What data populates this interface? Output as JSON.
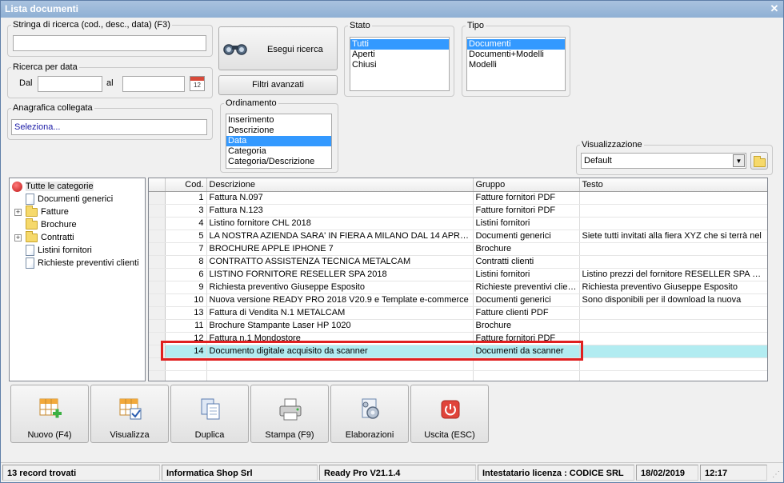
{
  "window": {
    "title": "Lista documenti",
    "close_glyph": "✕"
  },
  "search": {
    "legend": "Stringa di ricerca (cod., desc., data) (F3)",
    "value": ""
  },
  "date_search": {
    "legend": "Ricerca per data",
    "from_label": "Dal",
    "to_label": "al",
    "from_value": "",
    "to_value": "",
    "calendar_day": "12"
  },
  "linked_registry": {
    "legend": "Anagrafica collegata",
    "value": "Seleziona..."
  },
  "buttons": {
    "search": "Esegui ricerca",
    "advanced": "Filtri avanzati"
  },
  "ordering": {
    "legend": "Ordinamento",
    "options": [
      "Inserimento",
      "Descrizione",
      "Data",
      "Categoria",
      "Categoria/Descrizione"
    ],
    "selected": "Data"
  },
  "state": {
    "legend": "Stato",
    "options": [
      "Tutti",
      "Aperti",
      "Chiusi"
    ],
    "selected": "Tutti"
  },
  "type": {
    "legend": "Tipo",
    "options": [
      "Documenti",
      "Documenti+Modelli",
      "Modelli"
    ],
    "selected": "Documenti"
  },
  "view": {
    "legend": "Visualizzazione",
    "value": "Default"
  },
  "tree": {
    "root": "Tutte le categorie",
    "items": [
      {
        "label": "Documenti generici",
        "icon": "doc",
        "expandable": false
      },
      {
        "label": "Fatture",
        "icon": "folder",
        "expandable": true
      },
      {
        "label": "Brochure",
        "icon": "folder",
        "expandable": false
      },
      {
        "label": "Contratti",
        "icon": "folder",
        "expandable": true
      },
      {
        "label": "Listini fornitori",
        "icon": "doc",
        "expandable": false
      },
      {
        "label": "Richieste preventivi clienti",
        "icon": "doc",
        "expandable": false
      }
    ]
  },
  "grid": {
    "columns": [
      "Cod.",
      "Descrizione",
      "Gruppo",
      "Testo"
    ],
    "rows": [
      {
        "cod": "1",
        "desc": "Fattura N.097",
        "group": "Fatture fornitori PDF",
        "text": ""
      },
      {
        "cod": "3",
        "desc": "Fattura N.123",
        "group": "Fatture fornitori PDF",
        "text": ""
      },
      {
        "cod": "4",
        "desc": "Listino fornitore CHL 2018",
        "group": "Listini fornitori",
        "text": ""
      },
      {
        "cod": "5",
        "desc": "LA NOSTRA AZIENDA SARA' IN FIERA A MILANO DAL 14 APRILE ...",
        "group": "Documenti generici",
        "text": "Siete tutti invitati alla fiera XYZ che si terrà nel"
      },
      {
        "cod": "7",
        "desc": "BROCHURE APPLE IPHONE 7",
        "group": "Brochure",
        "text": ""
      },
      {
        "cod": "8",
        "desc": "CONTRATTO ASSISTENZA TECNICA METALCAM",
        "group": "Contratti clienti",
        "text": ""
      },
      {
        "cod": "6",
        "desc": "LISTINO FORNITORE RESELLER SPA 2018",
        "group": "Listini fornitori",
        "text": "Listino prezzi del fornitore RESELLER SPA 20..."
      },
      {
        "cod": "9",
        "desc": "Richiesta preventivo Giuseppe Esposito",
        "group": "Richieste preventivi clienti",
        "text": "Richiesta preventivo Giuseppe Esposito"
      },
      {
        "cod": "10",
        "desc": "Nuova versione READY PRO 2018 V20.9 e Template e-commerce",
        "group": "Documenti generici",
        "text": "Sono disponibili per il download la nuova"
      },
      {
        "cod": "13",
        "desc": "Fattura di Vendita N.1 METALCAM",
        "group": "Fatture clienti PDF",
        "text": ""
      },
      {
        "cod": "11",
        "desc": "Brochure Stampante Laser HP 1020",
        "group": "Brochure",
        "text": ""
      },
      {
        "cod": "12",
        "desc": "Fattura n.1 Mondostore",
        "group": "Fatture fornitori PDF",
        "text": ""
      },
      {
        "cod": "14",
        "desc": "Documento digitale acquisito da scanner",
        "group": "Documenti da scanner",
        "text": ""
      }
    ],
    "highlighted_cod": "14"
  },
  "toolbar": {
    "new": "Nuovo (F4)",
    "view": "Visualizza",
    "duplicate": "Duplica",
    "print": "Stampa (F9)",
    "process": "Elaborazioni",
    "exit": "Uscita (ESC)"
  },
  "status": {
    "records": "13 record trovati",
    "company": "Informatica Shop Srl",
    "version": "Ready Pro V21.1.4",
    "license": "Intestatario licenza : CODICE SRL",
    "date": "18/02/2019",
    "time": "12:17"
  },
  "colors": {
    "selection": "#3399ff",
    "highlight_row": "#b2ecf1",
    "highlight_box": "#e02020",
    "title_bar": "#8fb0d4"
  }
}
